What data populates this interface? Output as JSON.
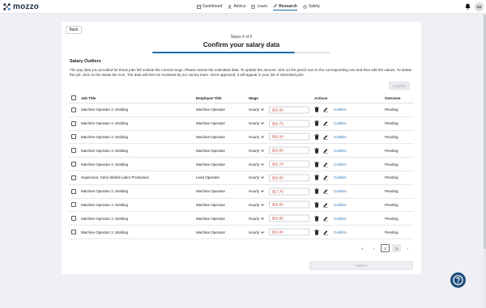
{
  "app": {
    "logo_text": "mozzo",
    "avatar_initials": "DS"
  },
  "nav": {
    "items": [
      {
        "label": "Dashboard",
        "icon": "dashboard-icon"
      },
      {
        "label": "Advice",
        "icon": "advice-icon"
      },
      {
        "label": "Learn",
        "icon": "learn-icon"
      },
      {
        "label": "Research",
        "icon": "research-icon",
        "active": true
      },
      {
        "label": "Safety",
        "icon": "safety-icon"
      }
    ]
  },
  "page": {
    "back_label": "Back",
    "steps_text": "Steps 4 of 5",
    "title": "Confirm your salary data",
    "progress": 0.8,
    "section_title": "Salary Outliers",
    "description": "The pay data you provided for these jobs fall outside the normal range. Please review the submitted data. To update the amount, click on the pencil icon in the corresponding row and then edit the values. To delete the job, click on the waste bin icon. The data will then be reviewed by our survey team. Once approved, it will appear in your list of submitted jobs.",
    "confirm_all_label": "Confirm",
    "submit_label": "Submit"
  },
  "table": {
    "headers": {
      "job": "Job Title",
      "emp": "Employee Title",
      "wage": "Wage",
      "actions": "Actions",
      "outcome": "Outcome"
    },
    "rows": [
      {
        "job": "Machine Operator 2, Molding",
        "emp": "Machine Operator",
        "wage": "Hourly",
        "amount": "$16.20",
        "confirm": "Confirm",
        "outcome": "Pending"
      },
      {
        "job": "Machine Operator 2, Molding",
        "emp": "Machine Operator",
        "wage": "Hourly",
        "amount": "$16.75",
        "confirm": "Confirm",
        "outcome": "Pending"
      },
      {
        "job": "Machine Operator 2, Molding",
        "emp": "Machine Operator",
        "wage": "Hourly",
        "amount": "$16.20",
        "confirm": "Confirm",
        "outcome": "Pending"
      },
      {
        "job": "Machine Operator 2, Molding",
        "emp": "Machine Operator",
        "wage": "Hourly",
        "amount": "$16.50",
        "confirm": "Confirm",
        "outcome": "Pending"
      },
      {
        "job": "Machine Operator 2, Molding",
        "emp": "Machine Operator",
        "wage": "Hourly",
        "amount": "$15.74",
        "confirm": "Confirm",
        "outcome": "Pending"
      },
      {
        "job": "Supervisor, Semi Skilled Labor Production",
        "emp": "Lead Operator",
        "wage": "Hourly",
        "amount": "$22.00",
        "confirm": "Confirm",
        "outcome": "Pending"
      },
      {
        "job": "Machine Operator 2, Molding",
        "emp": "Machine Operator",
        "wage": "Hourly",
        "amount": "$17.75",
        "confirm": "Confirm",
        "outcome": "Pending"
      },
      {
        "job": "Machine Operator 2, Molding",
        "emp": "Machine Operator",
        "wage": "Hourly",
        "amount": "$18.00",
        "confirm": "Confirm",
        "outcome": "Pending"
      },
      {
        "job": "Machine Operator 2, Molding",
        "emp": "Machine Operator",
        "wage": "Hourly",
        "amount": "$18.00",
        "confirm": "Confirm",
        "outcome": "Pending"
      },
      {
        "job": "Machine Operator 2, Molding",
        "emp": "Machine Operator",
        "wage": "Hourly",
        "amount": "$16.00",
        "confirm": "Confirm",
        "outcome": "Pending"
      }
    ]
  },
  "pagination": {
    "first": "«",
    "prev": "‹",
    "pages": [
      "2",
      "3"
    ],
    "next": "›"
  },
  "colors": {
    "accent": "#1e6aa8",
    "amount_text": "#c0392b",
    "help_bg": "#1f4f7d"
  }
}
